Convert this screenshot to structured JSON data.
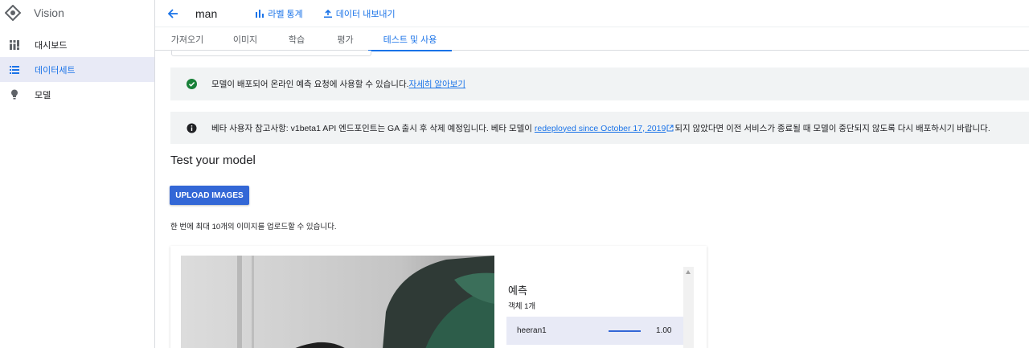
{
  "app": {
    "title": "Vision",
    "logo_icon": "vision-diamond-icon"
  },
  "sidebar": {
    "items": [
      {
        "label": "대시보드",
        "icon": "dashboard-icon",
        "active": false
      },
      {
        "label": "데이터세트",
        "icon": "list-icon",
        "active": true
      },
      {
        "label": "모델",
        "icon": "lightbulb-icon",
        "active": false
      }
    ]
  },
  "header": {
    "dataset_name": "man",
    "stats_label": "라벨 통계",
    "export_label": "데이터 내보내기"
  },
  "tabs": [
    {
      "label": "가져오기",
      "active": false
    },
    {
      "label": "이미지",
      "active": false
    },
    {
      "label": "학습",
      "active": false
    },
    {
      "label": "평가",
      "active": false
    },
    {
      "label": "테스트 및 사용",
      "active": true
    }
  ],
  "banners": {
    "success": {
      "text": "모델이 배포되어 온라인 예측 요청에 사용할 수 있습니다.",
      "link": "자세히 알아보기"
    },
    "beta": {
      "text_before": "베타 사용자 참고사항: v1beta1 API 엔드포인트는 GA 출시 후 삭제 예정입니다. 베타 모델이 ",
      "link": "redeployed since October 17, 2019",
      "text_after": "되지 않았다면 이전 서비스가 종료될 때 모델이 중단되지 않도록 다시 배포하시기 바랍니다."
    }
  },
  "test": {
    "title": "Test your model",
    "upload_label": "UPLOAD IMAGES",
    "hint": "한 번에 최대 10개의 이미지를 업로드할 수 있습니다."
  },
  "prediction": {
    "title": "예측",
    "count": "객체 1개",
    "rows": [
      {
        "label": "heeran1",
        "score": "1.00",
        "fraction": 1.0
      }
    ]
  },
  "colors": {
    "accent": "#1a73e8",
    "button": "#3367d6",
    "success": "#188038",
    "banner_bg": "#f1f3f4"
  }
}
